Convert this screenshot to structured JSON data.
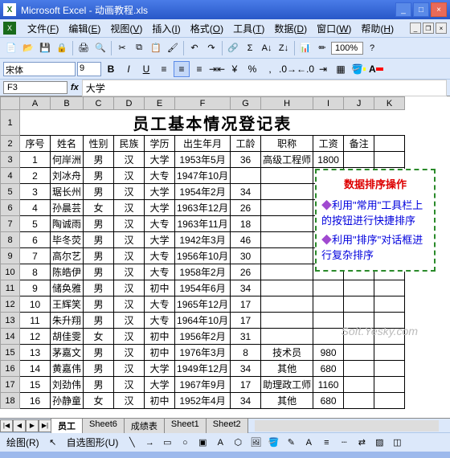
{
  "window": {
    "title": "Microsoft Excel - 动画教程.xls",
    "app_letter": "X"
  },
  "menus": [
    {
      "label": "文件",
      "accel": "F"
    },
    {
      "label": "编辑",
      "accel": "E"
    },
    {
      "label": "视图",
      "accel": "V"
    },
    {
      "label": "插入",
      "accel": "I"
    },
    {
      "label": "格式",
      "accel": "O"
    },
    {
      "label": "工具",
      "accel": "T"
    },
    {
      "label": "数据",
      "accel": "D"
    },
    {
      "label": "窗口",
      "accel": "W"
    },
    {
      "label": "帮助",
      "accel": "H"
    }
  ],
  "toolbar": {
    "zoom": "100%"
  },
  "format": {
    "font_name": "宋体",
    "font_size": "9"
  },
  "formula_bar": {
    "cell_ref": "F3",
    "fx_label": "fx",
    "value": "大学"
  },
  "columns": [
    "A",
    "B",
    "C",
    "D",
    "E",
    "F",
    "G",
    "H",
    "I",
    "J",
    "K"
  ],
  "title": "员工基本情况登记表",
  "headers": [
    "序号",
    "姓名",
    "性别",
    "民族",
    "学历",
    "出生年月",
    "工龄",
    "职称",
    "工资",
    "备注"
  ],
  "rows": [
    [
      "1",
      "何岸洲",
      "男",
      "汉",
      "大学",
      "1953年5月",
      "36",
      "高级工程师",
      "1800",
      ""
    ],
    [
      "2",
      "刘冰舟",
      "男",
      "汉",
      "大专",
      "1947年10月",
      "",
      "",
      "",
      ""
    ],
    [
      "3",
      "琚长州",
      "男",
      "汉",
      "大学",
      "1954年2月",
      "34",
      "",
      "",
      ""
    ],
    [
      "4",
      "孙晨芸",
      "女",
      "汉",
      "大学",
      "1963年12月",
      "26",
      "",
      "",
      ""
    ],
    [
      "5",
      "陶诚雨",
      "男",
      "汉",
      "大专",
      "1963年11月",
      "18",
      "",
      "",
      ""
    ],
    [
      "6",
      "毕冬荧",
      "男",
      "汉",
      "大学",
      "1942年3月",
      "46",
      "",
      "",
      ""
    ],
    [
      "7",
      "高尔艺",
      "男",
      "汉",
      "大专",
      "1956年10月",
      "30",
      "",
      "",
      ""
    ],
    [
      "8",
      "陈皓伊",
      "男",
      "汉",
      "大专",
      "1958年2月",
      "26",
      "",
      "",
      ""
    ],
    [
      "9",
      "储奂雅",
      "男",
      "汉",
      "初中",
      "1954年6月",
      "34",
      "",
      "",
      ""
    ],
    [
      "10",
      "王辉笑",
      "男",
      "汉",
      "大专",
      "1965年12月",
      "17",
      "",
      "",
      ""
    ],
    [
      "11",
      "朱升翔",
      "男",
      "汉",
      "大专",
      "1964年10月",
      "17",
      "",
      "",
      ""
    ],
    [
      "12",
      "胡佳雯",
      "女",
      "汉",
      "初中",
      "1956年2月",
      "31",
      "",
      "",
      ""
    ],
    [
      "13",
      "茅嘉文",
      "男",
      "汉",
      "初中",
      "1976年3月",
      "8",
      "技术员",
      "980",
      ""
    ],
    [
      "14",
      "黄嘉伟",
      "男",
      "汉",
      "大学",
      "1949年12月",
      "34",
      "其他",
      "680",
      ""
    ],
    [
      "15",
      "刘劲伟",
      "男",
      "汉",
      "大学",
      "1967年9月",
      "17",
      "助理政工师",
      "1160",
      ""
    ],
    [
      "16",
      "孙静童",
      "女",
      "汉",
      "初中",
      "1952年4月",
      "34",
      "其他",
      "680",
      ""
    ]
  ],
  "overlay": {
    "title": "数据排序操作",
    "items": [
      "利用\"常用\"工具栏上的按钮进行快捷排序",
      "利用\"排序\"对话框进行复杂排序"
    ]
  },
  "watermark": "Soft.Yesky.com",
  "sheets": {
    "active": "员工",
    "others": [
      "Sheet6",
      "成绩表",
      "Sheet1",
      "Sheet2"
    ]
  },
  "drawing": {
    "label": "绘图(R)",
    "autoshape": "自选图形(U)"
  },
  "chart_data": null
}
